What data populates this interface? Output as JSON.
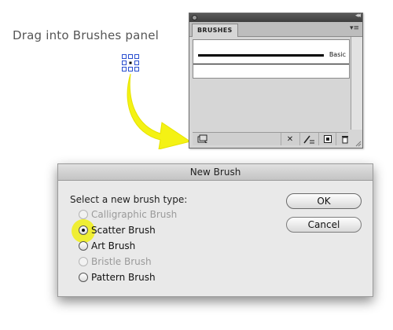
{
  "caption": "Drag into Brushes panel",
  "brushes_panel": {
    "tab_label": "BRUSHES",
    "brushes": [
      {
        "name": "Basic"
      }
    ],
    "footer_icons": [
      "brush-libraries-icon",
      "remove-stroke-icon",
      "brush-options-icon",
      "new-brush-icon",
      "delete-brush-icon"
    ]
  },
  "dialog": {
    "title": "New Brush",
    "prompt": "Select a new brush type:",
    "options": [
      {
        "label": "Calligraphic Brush",
        "enabled": false,
        "selected": false
      },
      {
        "label": "Scatter Brush",
        "enabled": true,
        "selected": true
      },
      {
        "label": "Art Brush",
        "enabled": true,
        "selected": false
      },
      {
        "label": "Bristle Brush",
        "enabled": false,
        "selected": false
      },
      {
        "label": "Pattern Brush",
        "enabled": true,
        "selected": false
      }
    ],
    "ok_label": "OK",
    "cancel_label": "Cancel"
  },
  "colors": {
    "highlight": "#f0ee14",
    "arrow": "#f4f214",
    "selection": "#2a4fd0"
  }
}
